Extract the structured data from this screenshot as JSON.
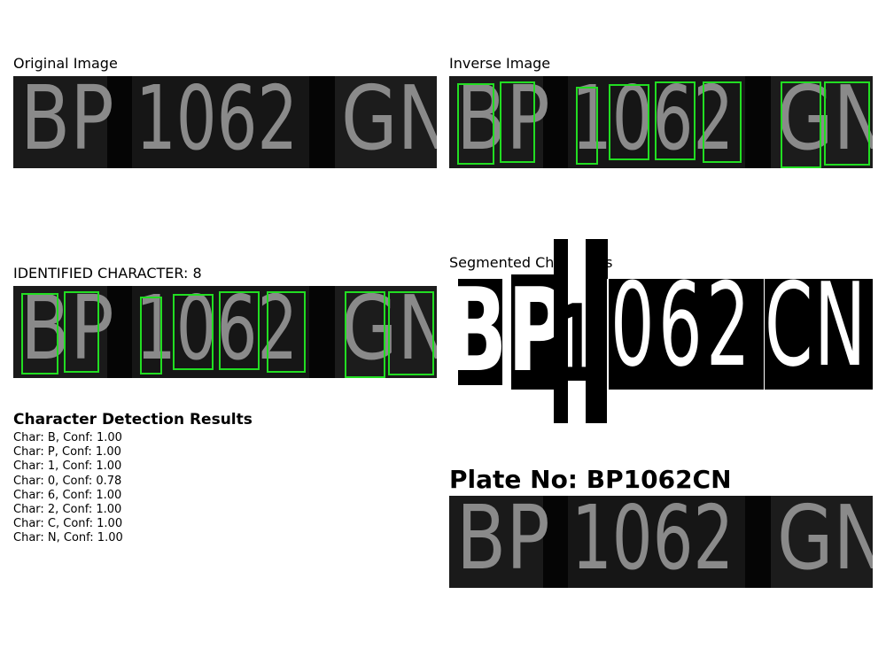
{
  "panels": {
    "original_title": "Original Image",
    "inverse_title": "Inverse Image",
    "identified_title": "IDENTIFIED CHARACTER: 8",
    "segmented_title": "Segmented Characters"
  },
  "plate_chars": {
    "group1": "BP",
    "group2": "1062",
    "group3": "GN"
  },
  "segmented_chars": [
    "B",
    "P",
    "1",
    "0",
    "6",
    "2",
    "C",
    "N"
  ],
  "results": {
    "heading": "Character Detection Results",
    "items": [
      "Char: B, Conf: 1.00",
      "Char: P, Conf: 1.00",
      "Char: 1, Conf: 1.00",
      "Char: 0, Conf: 0.78",
      "Char: 6, Conf: 1.00",
      "Char: 2, Conf: 1.00",
      "Char: C, Conf: 1.00",
      "Char: N, Conf: 1.00"
    ]
  },
  "plate_result": {
    "label": "Plate No: BP1062CN"
  },
  "colors": {
    "box": "#22dd22",
    "plate_bg": "#050505",
    "glyph": "#8a8a8a"
  }
}
